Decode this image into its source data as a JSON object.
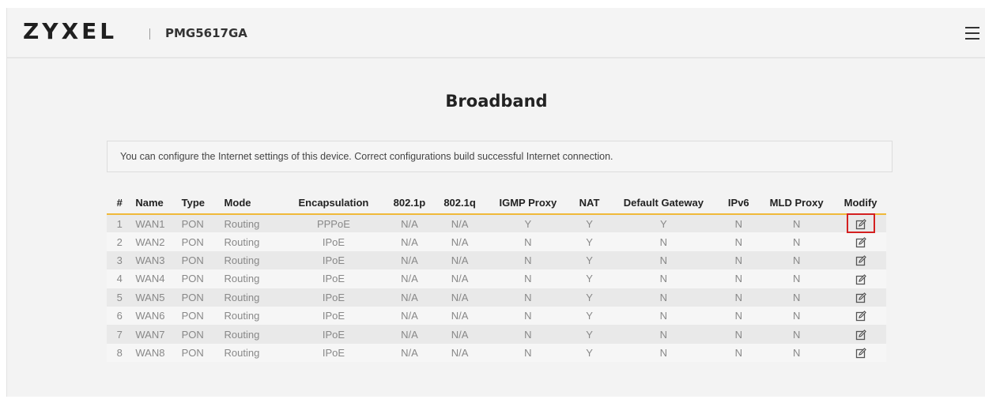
{
  "header": {
    "brand": "ZYXEL",
    "model": "PMG5617GA"
  },
  "page": {
    "title": "Broadband",
    "description": "You can configure the Internet settings of this device. Correct configurations build successful Internet connection."
  },
  "table": {
    "columns": [
      "#",
      "Name",
      "Type",
      "Mode",
      "Encapsulation",
      "802.1p",
      "802.1q",
      "IGMP Proxy",
      "NAT",
      "Default Gateway",
      "IPv6",
      "MLD Proxy",
      "Modify"
    ],
    "rows": [
      {
        "num": "1",
        "name": "WAN1",
        "type": "PON",
        "mode": "Routing",
        "encap": "PPPoE",
        "p8021p": "N/A",
        "p8021q": "N/A",
        "igmp": "Y",
        "nat": "Y",
        "gateway": "Y",
        "ipv6": "N",
        "mld": "N"
      },
      {
        "num": "2",
        "name": "WAN2",
        "type": "PON",
        "mode": "Routing",
        "encap": "IPoE",
        "p8021p": "N/A",
        "p8021q": "N/A",
        "igmp": "N",
        "nat": "Y",
        "gateway": "N",
        "ipv6": "N",
        "mld": "N"
      },
      {
        "num": "3",
        "name": "WAN3",
        "type": "PON",
        "mode": "Routing",
        "encap": "IPoE",
        "p8021p": "N/A",
        "p8021q": "N/A",
        "igmp": "N",
        "nat": "Y",
        "gateway": "N",
        "ipv6": "N",
        "mld": "N"
      },
      {
        "num": "4",
        "name": "WAN4",
        "type": "PON",
        "mode": "Routing",
        "encap": "IPoE",
        "p8021p": "N/A",
        "p8021q": "N/A",
        "igmp": "N",
        "nat": "Y",
        "gateway": "N",
        "ipv6": "N",
        "mld": "N"
      },
      {
        "num": "5",
        "name": "WAN5",
        "type": "PON",
        "mode": "Routing",
        "encap": "IPoE",
        "p8021p": "N/A",
        "p8021q": "N/A",
        "igmp": "N",
        "nat": "Y",
        "gateway": "N",
        "ipv6": "N",
        "mld": "N"
      },
      {
        "num": "6",
        "name": "WAN6",
        "type": "PON",
        "mode": "Routing",
        "encap": "IPoE",
        "p8021p": "N/A",
        "p8021q": "N/A",
        "igmp": "N",
        "nat": "Y",
        "gateway": "N",
        "ipv6": "N",
        "mld": "N"
      },
      {
        "num": "7",
        "name": "WAN7",
        "type": "PON",
        "mode": "Routing",
        "encap": "IPoE",
        "p8021p": "N/A",
        "p8021q": "N/A",
        "igmp": "N",
        "nat": "Y",
        "gateway": "N",
        "ipv6": "N",
        "mld": "N"
      },
      {
        "num": "8",
        "name": "WAN8",
        "type": "PON",
        "mode": "Routing",
        "encap": "IPoE",
        "p8021p": "N/A",
        "p8021q": "N/A",
        "igmp": "N",
        "nat": "Y",
        "gateway": "N",
        "ipv6": "N",
        "mld": "N"
      }
    ],
    "modify_icon": "edit-icon"
  },
  "colors": {
    "accent_underline": "#f0b93a",
    "highlight_box": "#d42020"
  }
}
